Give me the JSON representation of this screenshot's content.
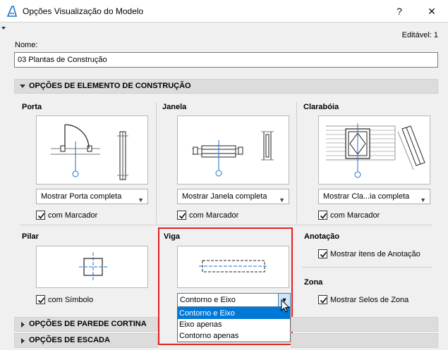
{
  "window": {
    "title": "Opções Visualização do Modelo",
    "help_glyph": "?",
    "close_glyph": "✕"
  },
  "editable": "Editável: 1",
  "nome": {
    "label": "Nome:",
    "value": "03 Plantas de Construção"
  },
  "sections": {
    "construction": "OPÇÕES DE ELEMENTO DE CONSTRUÇÃO",
    "curtain_wall": "OPÇÕES DE PAREDE CORTINA",
    "stair": "OPÇÕES DE ESCADA"
  },
  "porta": {
    "title": "Porta",
    "dropdown": "Mostrar Porta completa",
    "checkbox": "com Marcador",
    "checked": true
  },
  "janela": {
    "title": "Janela",
    "dropdown": "Mostrar Janela completa",
    "checkbox": "com Marcador",
    "checked": true
  },
  "claraboia": {
    "title": "Clarabóia",
    "dropdown": "Mostrar Cla...ia completa",
    "checkbox": "com Marcador",
    "checked": true
  },
  "pilar": {
    "title": "Pilar",
    "checkbox": "com Símbolo",
    "checked": true
  },
  "viga": {
    "title": "Viga",
    "combo_value": "Contorno e Eixo",
    "options": [
      "Contorno e Eixo",
      "Eixo apenas",
      "Contorno apenas"
    ],
    "selected_index": 0
  },
  "anotacao": {
    "title": "Anotação",
    "checkbox": "Mostrar itens de Anotação",
    "checked": true
  },
  "zona": {
    "title": "Zona",
    "checkbox": "Mostrar Selos de Zona",
    "checked": true
  },
  "colors": {
    "highlight": "#e02020",
    "selection": "#0078d7",
    "symbol_blue": "#1e6fd0"
  },
  "icons": [
    "archicad-app-icon",
    "help-icon",
    "close-icon",
    "chevron-down-icon",
    "checkmark-icon",
    "mouse-pointer-icon"
  ]
}
